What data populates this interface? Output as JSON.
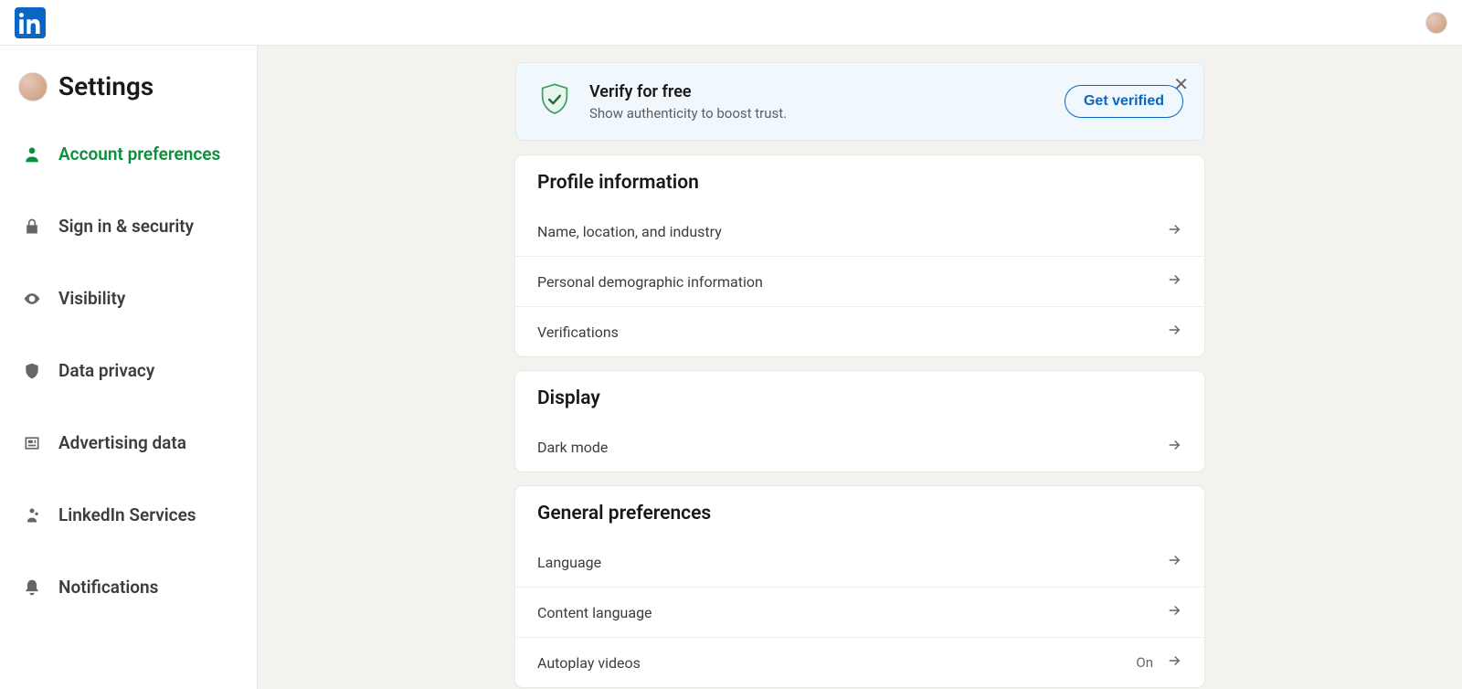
{
  "header": {
    "title": "Settings"
  },
  "sidebar": {
    "items": [
      {
        "label": "Account preferences",
        "active": true
      },
      {
        "label": "Sign in & security"
      },
      {
        "label": "Visibility"
      },
      {
        "label": "Data privacy"
      },
      {
        "label": "Advertising data"
      },
      {
        "label": "LinkedIn Services"
      },
      {
        "label": "Notifications"
      }
    ]
  },
  "banner": {
    "title": "Verify for free",
    "subtitle": "Show authenticity to boost trust.",
    "button": "Get verified"
  },
  "sections": {
    "profile": {
      "title": "Profile information",
      "rows": [
        {
          "label": "Name, location, and industry"
        },
        {
          "label": "Personal demographic information"
        },
        {
          "label": "Verifications"
        }
      ]
    },
    "display": {
      "title": "Display",
      "rows": [
        {
          "label": "Dark mode"
        }
      ]
    },
    "general": {
      "title": "General preferences",
      "rows": [
        {
          "label": "Language"
        },
        {
          "label": "Content language"
        },
        {
          "label": "Autoplay videos",
          "value": "On"
        }
      ]
    }
  }
}
